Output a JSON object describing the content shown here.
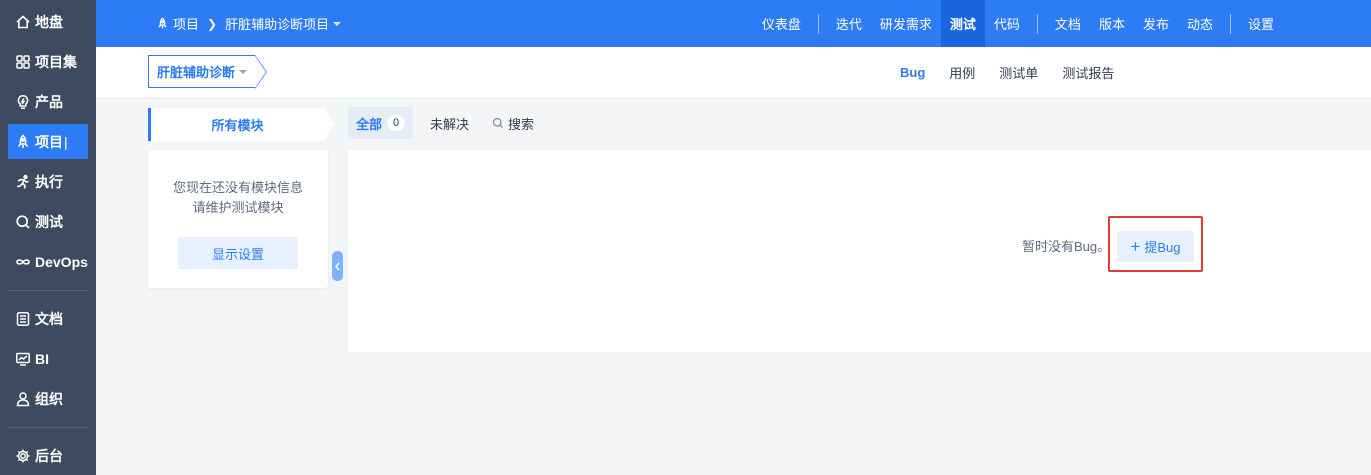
{
  "sidebar": {
    "items": [
      {
        "label": "地盘",
        "icon": "home-icon"
      },
      {
        "label": "项目集",
        "icon": "grid-icon"
      },
      {
        "label": "产品",
        "icon": "lightbulb-icon"
      },
      {
        "label": "项目",
        "icon": "rocket-icon"
      },
      {
        "label": "执行",
        "icon": "running-icon"
      },
      {
        "label": "测试",
        "icon": "search-icon"
      },
      {
        "label": "DevOps",
        "icon": "infinity-icon"
      },
      {
        "label": "文档",
        "icon": "document-icon"
      },
      {
        "label": "BI",
        "icon": "monitor-icon"
      },
      {
        "label": "组织",
        "icon": "user-icon"
      },
      {
        "label": "后台",
        "icon": "gear-icon"
      }
    ],
    "active_label": "项目"
  },
  "header": {
    "breadcrumb": {
      "root": "项目",
      "current": "肝脏辅助诊断项目"
    },
    "nav": [
      "仪表盘",
      "迭代",
      "研发需求",
      "测试",
      "代码",
      "文档",
      "版本",
      "发布",
      "动态",
      "设置"
    ],
    "active_nav": "测试"
  },
  "subbar": {
    "selector": "肝脏辅助诊断",
    "tabs": [
      "Bug",
      "用例",
      "测试单",
      "测试报告"
    ],
    "active_tab": "Bug"
  },
  "module": {
    "title": "所有模块",
    "empty_line1": "您现在还没有模块信息",
    "empty_line2": "请维护测试模块",
    "button": "显示设置"
  },
  "filters": {
    "all_label": "全部",
    "all_count": "0",
    "unresolved": "未解决",
    "search": "搜索"
  },
  "content": {
    "empty_text": "暂时没有Bug。",
    "add_button": "提Bug"
  },
  "colors": {
    "sidebar_bg": "#3d4a5f",
    "primary": "#2e7bf6",
    "highlight": "#e53935"
  }
}
